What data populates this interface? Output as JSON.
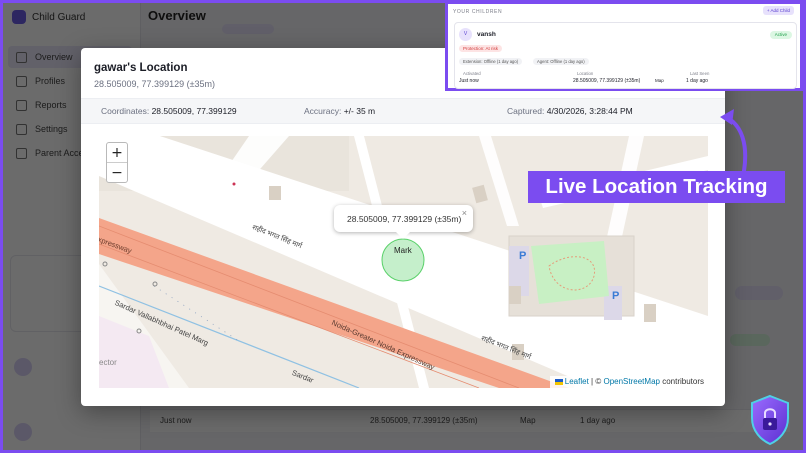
{
  "background_app": {
    "brand": "Child Guard",
    "page_title": "Overview",
    "page_subtitle": "",
    "nav": [
      "Overview",
      "Profiles",
      "Reports",
      "Settings",
      "Parent Access"
    ],
    "child_name": "vansh",
    "rows": [
      {
        "label": "Just now",
        "location": "28.505009, 77.399129 (±35m)",
        "map": "Map",
        "last_seen": "1 day ago"
      }
    ]
  },
  "modal": {
    "title": "gawar's Location",
    "subtitle": "28.505009, 77.399129 (±35m)",
    "coordinates_label": "Coordinates:",
    "coordinates_value": "28.505009, 77.399129",
    "accuracy_label": "Accuracy:",
    "accuracy_value": "+/- 35 m",
    "captured_label": "Captured:",
    "captured_value": "4/30/2026, 3:28:44 PM"
  },
  "map": {
    "zoom_in": "+",
    "zoom_out": "−",
    "popup_text": "28.505009, 77.399129 (±35m)",
    "popup_close": "×",
    "marker_label": "Mark",
    "road_expressway": "Expressway",
    "road_noida": "Noida-Greater Noida Expressway",
    "road_sardar_1": "Sardar Vallabhbhai Patel Marg",
    "road_sardar_2": "Sardar",
    "road_hindi_1": "शहीद भगत सिंह मार्ग",
    "road_hindi_2": "शहीद भगत सिंह मार्ग",
    "road_sector": "ector",
    "parking_1": "P",
    "parking_2": "P",
    "attribution_leaflet": "Leaflet",
    "attribution_sep": "| ©",
    "attribution_osm": "OpenStreetMap",
    "attribution_contrib": "contributors"
  },
  "inset": {
    "section_title": "YOUR CHILDREN",
    "add_button": "+ Add Child",
    "avatar_initial": "V",
    "child_name": "vansh",
    "status_badge": "Active",
    "protection_badge": "Protection: At risk",
    "extension_badge": "Extension: Offline (1 day ago)",
    "agent_badge": "Agent: Offline (1 day ago)",
    "activated_label": "Activated",
    "activated_value": "Just now",
    "location_label": "Location",
    "location_value": "28.505009, 77.399129 (±35m)",
    "map_link": "Map",
    "last_seen_label": "Last Seen",
    "last_seen_value": "1 day ago"
  },
  "callout": {
    "text": "Live Location Tracking"
  },
  "colors": {
    "accent": "#7b4cf0",
    "expressway": "#f4a58a",
    "park": "#c8f0c4",
    "marker": "#5ad16a"
  }
}
